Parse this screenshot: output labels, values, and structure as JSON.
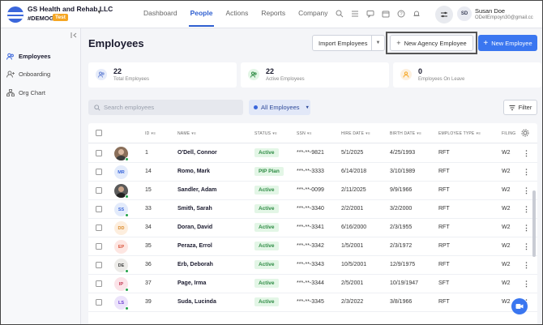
{
  "org": {
    "name": "GS Health and Rehab LLC",
    "code": "#DEMOGS",
    "badge": "Test"
  },
  "nav": {
    "tabs": [
      "Dashboard",
      "People",
      "Actions",
      "Reports",
      "Company"
    ],
    "active": "People"
  },
  "user": {
    "initials": "SD",
    "name": "Susan Doe",
    "email": "ODellEmpoyn30@gmail.cc"
  },
  "sidebar": {
    "items": [
      {
        "label": "Employees",
        "icon": "people-icon",
        "active": true
      },
      {
        "label": "Onboarding",
        "icon": "onboarding-icon",
        "active": false
      },
      {
        "label": "Org Chart",
        "icon": "org-chart-icon",
        "active": false
      }
    ]
  },
  "page": {
    "title": "Employees",
    "import_label": "Import Employees",
    "agency_label": "New Agency Employee",
    "new_label": "New Employee",
    "search_placeholder": "Search employees",
    "filter_pill": "All Employees",
    "filter_label": "Filter"
  },
  "stats": [
    {
      "value": "22",
      "label": "Total Employees",
      "color": "#6b87d6"
    },
    {
      "value": "22",
      "label": "Active Employees",
      "color": "#2e8b44"
    },
    {
      "value": "0",
      "label": "Employees On Leave",
      "color": "#f5a623"
    }
  ],
  "table": {
    "columns": [
      "ID",
      "NAME",
      "STATUS",
      "SSN",
      "HIRE DATE",
      "BIRTH DATE",
      "EMPLOYEE TYPE",
      "FILING"
    ],
    "rows": [
      {
        "avatar": "photo",
        "initials": "",
        "id": "1",
        "name": "O'Dell, Connor",
        "status": "Active",
        "ssn": "***-**-9821",
        "hire": "5/1/2025",
        "birth": "4/25/1993",
        "type": "RFT",
        "filing": "W2",
        "online": true
      },
      {
        "avatar": "initials",
        "initials": "MR",
        "bg": "#e3ebfb",
        "fg": "#3a66db",
        "id": "14",
        "name": "Romo, Mark",
        "status": "PIP Plan",
        "ssn": "***-**-3333",
        "hire": "6/14/2018",
        "birth": "3/10/1989",
        "type": "RFT",
        "filing": "W2",
        "online": false
      },
      {
        "avatar": "photo2",
        "initials": "",
        "id": "15",
        "name": "Sandler, Adam",
        "status": "Active",
        "ssn": "***-**-0099",
        "hire": "2/11/2025",
        "birth": "9/9/1966",
        "type": "RFT",
        "filing": "W2",
        "online": true
      },
      {
        "avatar": "initials",
        "initials": "SS",
        "bg": "#e3ebfb",
        "fg": "#3a66db",
        "id": "33",
        "name": "Smith, Sarah",
        "status": "Active",
        "ssn": "***-**-3340",
        "hire": "2/2/2001",
        "birth": "3/2/2000",
        "type": "RFT",
        "filing": "W2",
        "online": true
      },
      {
        "avatar": "initials",
        "initials": "DD",
        "bg": "#fdeede",
        "fg": "#d98a2b",
        "id": "34",
        "name": "Doran, David",
        "status": "Active",
        "ssn": "***-**-3341",
        "hire": "6/16/2000",
        "birth": "2/3/1955",
        "type": "RFT",
        "filing": "W2",
        "online": false
      },
      {
        "avatar": "initials",
        "initials": "EP",
        "bg": "#fde6e2",
        "fg": "#d9543b",
        "id": "35",
        "name": "Peraza, Errol",
        "status": "Active",
        "ssn": "***-**-3342",
        "hire": "1/5/2001",
        "birth": "2/3/1972",
        "type": "RPT",
        "filing": "W2",
        "online": false
      },
      {
        "avatar": "initials",
        "initials": "DE",
        "bg": "#ecebe8",
        "fg": "#444444",
        "id": "36",
        "name": "Erb, Deborah",
        "status": "Active",
        "ssn": "***-**-3343",
        "hire": "10/5/2001",
        "birth": "12/9/1975",
        "type": "RFT",
        "filing": "W2",
        "online": true
      },
      {
        "avatar": "initials",
        "initials": "IP",
        "bg": "#fbe3e8",
        "fg": "#c2334e",
        "id": "37",
        "name": "Page, Irma",
        "status": "Active",
        "ssn": "***-**-3344",
        "hire": "2/5/2001",
        "birth": "10/19/1947",
        "type": "SFT",
        "filing": "W2",
        "online": true
      },
      {
        "avatar": "initials",
        "initials": "LS",
        "bg": "#ece3fb",
        "fg": "#6a3ad0",
        "id": "39",
        "name": "Suda, Lucinda",
        "status": "Active",
        "ssn": "***-**-3345",
        "hire": "2/3/2022",
        "birth": "3/8/1966",
        "type": "RFT",
        "filing": "W2",
        "online": true
      }
    ]
  }
}
